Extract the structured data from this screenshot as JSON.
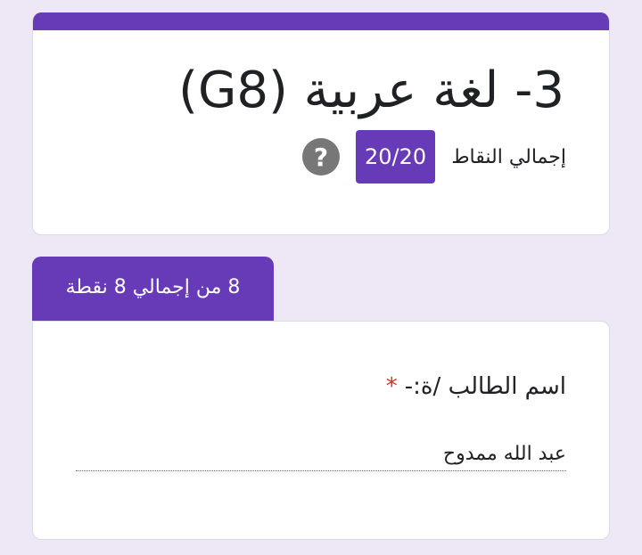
{
  "form": {
    "title": "3- لغة عربية (G8)",
    "total_points_label": "إجمالي النقاط",
    "score": "20/20",
    "help_icon": "question-mark-icon"
  },
  "section": {
    "score_text": "8 من إجمالي 8 نقطة"
  },
  "question": {
    "title": "اسم الطالب /ة:-",
    "required_marker": "*",
    "answer": "عبد الله ممدوح"
  },
  "colors": {
    "accent": "#673ab7",
    "background": "#ede7f6",
    "required": "#d93025"
  }
}
